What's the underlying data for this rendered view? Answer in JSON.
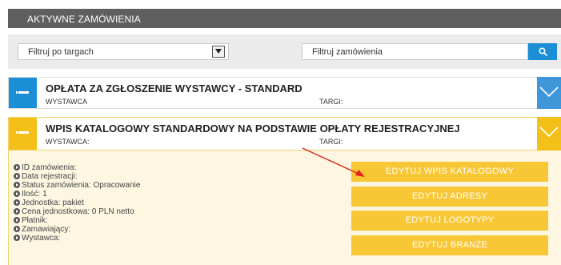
{
  "header": {
    "title": "AKTYWNE ZAMÓWIENIA"
  },
  "filters": {
    "fair_select_value": "Filtruj po targach",
    "order_search_placeholder": "Filtruj zamówienia"
  },
  "orders": [
    {
      "title": "OPŁATA ZA ZGŁOSZENIE WYSTAWCY - STANDARD",
      "exhibitor_label": "WYSTAWCA",
      "fair_label": "TARGI:",
      "state": "collapsed"
    },
    {
      "title": "WPIS KATALOGOWY STANDARDOWY NA PODSTAWIE OPŁATY REJESTRACYJNEJ",
      "exhibitor_label": "WYSTAWCA:",
      "fair_label": "TARGI:",
      "state": "expanded",
      "details": [
        "ID zamówienia:",
        "Data rejestracji:",
        "Status zamówienia: Opracowanie",
        "Ilość: 1",
        "Jednostka: pakiet",
        "Cena jednostkowa: 0 PLN netto",
        "Płatnik:",
        "Zamawiający:",
        "Wystawca:"
      ],
      "actions": [
        "EDYTUJ WPIS KATALOGOWY",
        "EDYTUJ ADRESY",
        "EDYTUJ LOGOTYPY",
        "EDYTUJ BRANŻE"
      ]
    }
  ],
  "colors": {
    "header_bg": "#5f5f5f",
    "accent_blue": "#1a8fd6",
    "accent_yellow": "#f3c019",
    "button_yellow": "#f8c735",
    "annotation_arrow": "#e3201b"
  },
  "icons": {
    "search": "search-icon",
    "dropdown": "chevron-down-icon",
    "collapse": "minus-icon",
    "expand": "chevron-down-icon",
    "bullet": "circle-arrow-right-icon"
  }
}
